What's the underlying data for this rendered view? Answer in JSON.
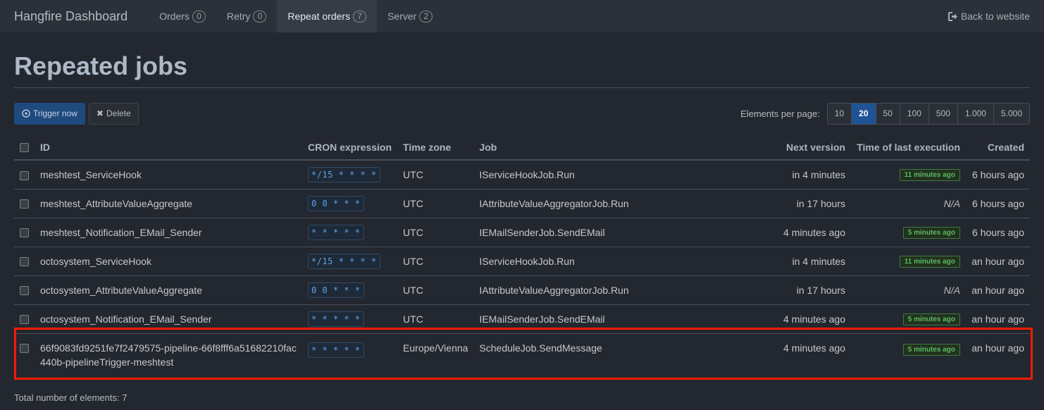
{
  "navbar": {
    "brand": "Hangfire Dashboard",
    "items": [
      {
        "label": "Orders",
        "count": "0",
        "active": false
      },
      {
        "label": "Retry",
        "count": "0",
        "active": false
      },
      {
        "label": "Repeat orders",
        "count": "7",
        "active": true
      },
      {
        "label": "Server",
        "count": "2",
        "active": false
      }
    ],
    "back_label": "Back to website"
  },
  "page": {
    "title": "Repeated jobs",
    "trigger_label": "Trigger now",
    "delete_label": "Delete",
    "per_page_label": "Elements per page:",
    "per_page_options": [
      "10",
      "20",
      "50",
      "100",
      "500",
      "1.000",
      "5.000"
    ],
    "per_page_selected": "20",
    "total_label": "Total number of elements: 7"
  },
  "table": {
    "headers": {
      "id": "ID",
      "cron": "CRON expression",
      "timezone": "Time zone",
      "job": "Job",
      "next": "Next version",
      "last": "Time of last execution",
      "created": "Created"
    },
    "rows": [
      {
        "id": "meshtest_ServiceHook",
        "cron": "*/15 * * * *",
        "timezone": "UTC",
        "job": "IServiceHookJob.Run",
        "next": "in 4 minutes",
        "last": "11 minutes ago",
        "last_status": "ok",
        "created": "6 hours ago"
      },
      {
        "id": "meshtest_AttributeValueAggregate",
        "cron": "0 0 * * *",
        "timezone": "UTC",
        "job": "IAttributeValueAggregatorJob.Run",
        "next": "in 17 hours",
        "last": "N/A",
        "last_status": "none",
        "created": "6 hours ago"
      },
      {
        "id": "meshtest_Notification_EMail_Sender",
        "cron": "* * * * *",
        "timezone": "UTC",
        "job": "IEMailSenderJob.SendEMail",
        "next": "4 minutes ago",
        "last": "5 minutes ago",
        "last_status": "ok",
        "created": "6 hours ago"
      },
      {
        "id": "octosystem_ServiceHook",
        "cron": "*/15 * * * *",
        "timezone": "UTC",
        "job": "IServiceHookJob.Run",
        "next": "in 4 minutes",
        "last": "11 minutes ago",
        "last_status": "ok",
        "created": "an hour ago"
      },
      {
        "id": "octosystem_AttributeValueAggregate",
        "cron": "0 0 * * *",
        "timezone": "UTC",
        "job": "IAttributeValueAggregatorJob.Run",
        "next": "in 17 hours",
        "last": "N/A",
        "last_status": "none",
        "created": "an hour ago"
      },
      {
        "id": "octosystem_Notification_EMail_Sender",
        "cron": "* * * * *",
        "timezone": "UTC",
        "job": "IEMailSenderJob.SendEMail",
        "next": "4 minutes ago",
        "last": "5 minutes ago",
        "last_status": "ok",
        "created": "an hour ago"
      },
      {
        "id": "66f9083fd9251fe7f2479575-pipeline-66f8fff6a51682210fac440b-pipelineTrigger-meshtest",
        "cron": "* * * * *",
        "timezone": "Europe/Vienna",
        "job": "ScheduleJob.SendMessage",
        "next": "4 minutes ago",
        "last": "5 minutes ago",
        "last_status": "ok",
        "created": "an hour ago"
      }
    ]
  },
  "colors": {
    "accent": "#1f5396",
    "highlight": "#ff1a00",
    "success": "#5cb860"
  }
}
